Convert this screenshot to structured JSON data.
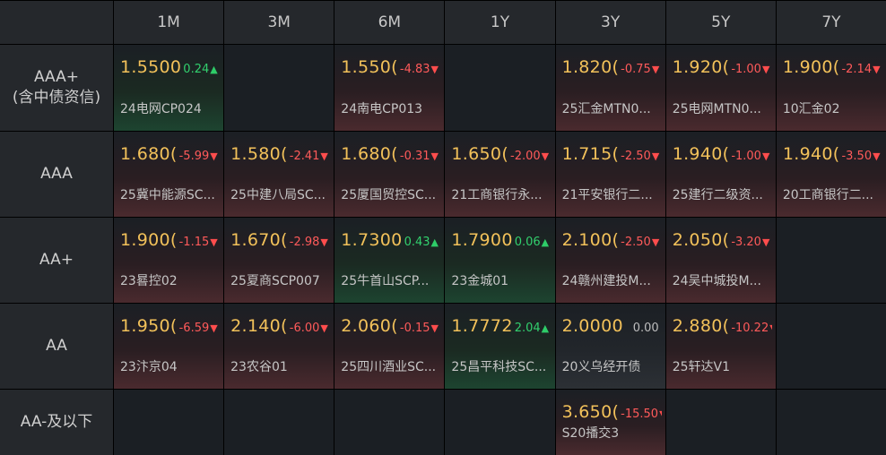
{
  "columns": [
    "1M",
    "3M",
    "6M",
    "1Y",
    "3Y",
    "5Y",
    "7Y"
  ],
  "colors": {
    "price": "#f2c15a",
    "down": "#ff5a5a",
    "up": "#32d06e"
  },
  "rows": [
    {
      "label": "AAA+\n(含中债资信)",
      "cells": [
        {
          "price": "1.5500",
          "change": "0.24",
          "dir": "up",
          "arrow": "▲",
          "name": "24电网CP024"
        },
        {},
        {
          "price": "1.550(",
          "change": "-4.83",
          "dir": "dn",
          "arrow": "▼",
          "name": "24南电CP013"
        },
        {},
        {
          "price": "1.820(",
          "change": "-0.75",
          "dir": "dn",
          "arrow": "▼",
          "name": "25汇金MTN0..."
        },
        {
          "price": "1.920(",
          "change": "-1.00",
          "dir": "dn",
          "arrow": "▼",
          "name": "25电网MTN0..."
        },
        {
          "price": "1.900(",
          "change": "-2.14",
          "dir": "dn",
          "arrow": "▼",
          "name": "10汇金02"
        }
      ]
    },
    {
      "label": "AAA",
      "cells": [
        {
          "price": "1.680(",
          "change": "-5.99",
          "dir": "dn",
          "arrow": "▼",
          "name": "25冀中能源SC..."
        },
        {
          "price": "1.580(",
          "change": "-2.41",
          "dir": "dn",
          "arrow": "▼",
          "name": "25中建八局SC..."
        },
        {
          "price": "1.680(",
          "change": "-0.31",
          "dir": "dn",
          "arrow": "▼",
          "name": "25厦国贸控SC..."
        },
        {
          "price": "1.650(",
          "change": "-2.00",
          "dir": "dn",
          "arrow": "▼",
          "name": "21工商银行永..."
        },
        {
          "price": "1.715(",
          "change": "-2.50",
          "dir": "dn",
          "arrow": "▼",
          "name": "21平安银行二..."
        },
        {
          "price": "1.940(",
          "change": "-1.00",
          "dir": "dn",
          "arrow": "▼",
          "name": "25建行二级资..."
        },
        {
          "price": "1.940(",
          "change": "-3.50",
          "dir": "dn",
          "arrow": "▼",
          "name": "20工商银行二..."
        }
      ]
    },
    {
      "label": "AA+",
      "cells": [
        {
          "price": "1.900(",
          "change": "-1.15",
          "dir": "dn",
          "arrow": "▼",
          "name": "23晷控02"
        },
        {
          "price": "1.670(",
          "change": "-2.98",
          "dir": "dn",
          "arrow": "▼",
          "name": "25夏商SCP007"
        },
        {
          "price": "1.7300",
          "change": "0.43",
          "dir": "up",
          "arrow": "▲",
          "name": "25牛首山SCP..."
        },
        {
          "price": "1.7900",
          "change": "0.06",
          "dir": "up",
          "arrow": "▲",
          "name": "23金城01"
        },
        {
          "price": "2.100(",
          "change": "-2.50",
          "dir": "dn",
          "arrow": "▼",
          "name": "24赣州建投M..."
        },
        {
          "price": "2.050(",
          "change": "-3.20",
          "dir": "dn",
          "arrow": "▼",
          "name": "24吴中城投M..."
        },
        {}
      ]
    },
    {
      "label": "AA",
      "cells": [
        {
          "price": "1.950(",
          "change": "-6.59",
          "dir": "dn",
          "arrow": "▼",
          "name": "23汴京04"
        },
        {
          "price": "2.140(",
          "change": "-6.00",
          "dir": "dn",
          "arrow": "▼",
          "name": "23农谷01"
        },
        {
          "price": "2.060(",
          "change": "-0.15",
          "dir": "dn",
          "arrow": "▼",
          "name": "25四川酒业SC..."
        },
        {
          "price": "1.7772",
          "change": "2.04",
          "dir": "up",
          "arrow": "▲",
          "name": "25昌平科技SC..."
        },
        {
          "price": "2.0000",
          "change": "0.00",
          "dir": "flat",
          "arrow": "",
          "name": "20义乌经开债"
        },
        {
          "price": "2.880(",
          "change": "-10.22",
          "dir": "dn",
          "arrow": "▼",
          "name": "25轩达V1"
        },
        {}
      ]
    },
    {
      "label": "AA-及以下",
      "cells": [
        {},
        {},
        {},
        {},
        {
          "price": "3.650(",
          "change": "-15.50",
          "dir": "dn",
          "arrow": "▼",
          "name": "S20播交3"
        },
        {},
        {}
      ]
    }
  ]
}
